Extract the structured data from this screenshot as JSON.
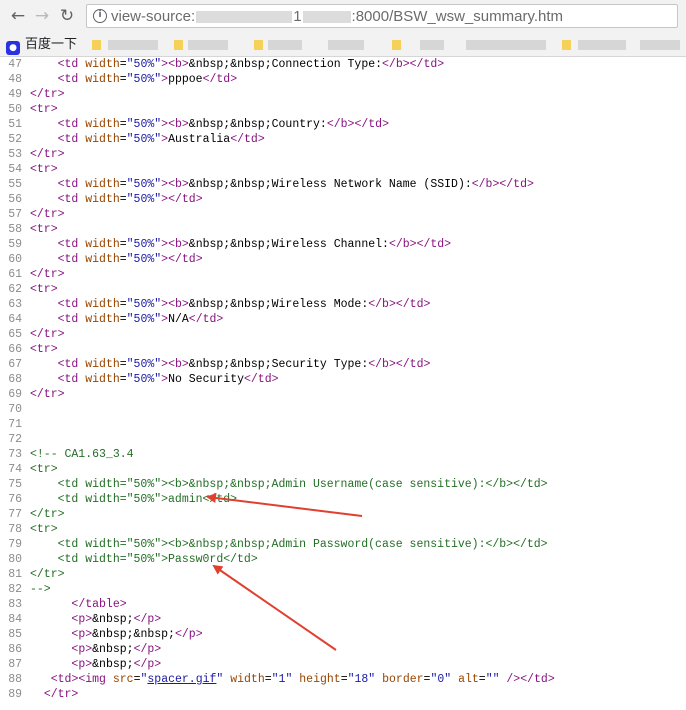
{
  "toolbar": {
    "back_icon": "arrow-back-icon",
    "forward_icon": "arrow-forward-icon",
    "reload_icon": "reload-icon",
    "url_prefix": "view-source:",
    "url_host_first": "1",
    "url_suffix": ":8000/BSW_wsw_summary.htm"
  },
  "bookmarks": {
    "first_label": "百度一下"
  },
  "source": {
    "lines": [
      {
        "n": "47",
        "code": "    <td width=\"50%\"><b>&nbsp;&nbsp;Connection Type:</b></td>"
      },
      {
        "n": "48",
        "code": "    <td width=\"50%\">pppoe</td>"
      },
      {
        "n": "49",
        "code": "</tr>"
      },
      {
        "n": "50",
        "code": "<tr>"
      },
      {
        "n": "51",
        "code": "    <td width=\"50%\"><b>&nbsp;&nbsp;Country:</b></td>"
      },
      {
        "n": "52",
        "code": "    <td width=\"50%\">Australia</td>"
      },
      {
        "n": "53",
        "code": "</tr>"
      },
      {
        "n": "54",
        "code": "<tr>"
      },
      {
        "n": "55",
        "code": "    <td width=\"50%\"><b>&nbsp;&nbsp;Wireless Network Name (SSID):</b></td>"
      },
      {
        "n": "56",
        "code": "    <td width=\"50%\"></td>"
      },
      {
        "n": "57",
        "code": "</tr>"
      },
      {
        "n": "58",
        "code": "<tr>"
      },
      {
        "n": "59",
        "code": "    <td width=\"50%\"><b>&nbsp;&nbsp;Wireless Channel:</b></td>"
      },
      {
        "n": "60",
        "code": "    <td width=\"50%\"></td>"
      },
      {
        "n": "61",
        "code": "</tr>"
      },
      {
        "n": "62",
        "code": "<tr>"
      },
      {
        "n": "63",
        "code": "    <td width=\"50%\"><b>&nbsp;&nbsp;Wireless Mode:</b></td>"
      },
      {
        "n": "64",
        "code": "    <td width=\"50%\">N/A</td>"
      },
      {
        "n": "65",
        "code": "</tr>"
      },
      {
        "n": "66",
        "code": "<tr>"
      },
      {
        "n": "67",
        "code": "    <td width=\"50%\"><b>&nbsp;&nbsp;Security Type:</b></td>"
      },
      {
        "n": "68",
        "code": "    <td width=\"50%\">No Security</td>"
      },
      {
        "n": "69",
        "code": "</tr>"
      },
      {
        "n": "70",
        "code": ""
      },
      {
        "n": "71",
        "code": ""
      },
      {
        "n": "72",
        "code": ""
      },
      {
        "n": "73",
        "code": "<!-- CA1.63_3.4",
        "comment": true
      },
      {
        "n": "74",
        "code": "<tr>",
        "comment": true
      },
      {
        "n": "75",
        "code": "    <td width=\"50%\"><b>&nbsp;&nbsp;Admin Username(case sensitive):</b></td>",
        "comment": true
      },
      {
        "n": "76",
        "code": "    <td width=\"50%\">admin</td>",
        "comment": true
      },
      {
        "n": "77",
        "code": "</tr>",
        "comment": true
      },
      {
        "n": "78",
        "code": "<tr>",
        "comment": true
      },
      {
        "n": "79",
        "code": "    <td width=\"50%\"><b>&nbsp;&nbsp;Admin Password(case sensitive):</b></td>",
        "comment": true
      },
      {
        "n": "80",
        "code": "    <td width=\"50%\">Passw0rd</td>",
        "comment": true
      },
      {
        "n": "81",
        "code": "</tr>",
        "comment": true
      },
      {
        "n": "82",
        "code": "-->",
        "comment": true
      },
      {
        "n": "83",
        "code": "      </table>"
      },
      {
        "n": "84",
        "code": "      <p>&nbsp;</p>"
      },
      {
        "n": "85",
        "code": "      <p>&nbsp;&nbsp;</p>"
      },
      {
        "n": "86",
        "code": "      <p>&nbsp;</p>"
      },
      {
        "n": "87",
        "code": "      <p>&nbsp;</p>"
      },
      {
        "n": "88",
        "code": "   <td><img src=\"spacer.gif\" width=\"1\" height=\"18\" border=\"0\" alt=\"\" /></td>",
        "link": "spacer.gif"
      },
      {
        "n": "89",
        "code": "  </tr>"
      }
    ]
  },
  "colors": {
    "tag": "#881280",
    "attr_name": "#994500",
    "attr_value": "#1a1aa6",
    "comment": "#236e25",
    "line_number": "#8c8c8c",
    "annotation_arrow": "#e0402f"
  }
}
